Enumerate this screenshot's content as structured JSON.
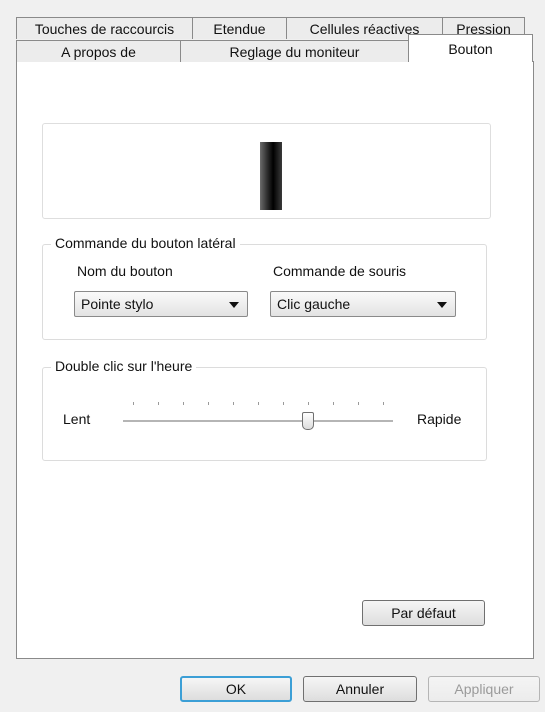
{
  "tabs": {
    "row1": [
      "Touches de raccourcis",
      "Etendue",
      "Cellules réactives",
      "Pression"
    ],
    "row2": [
      "A propos de",
      "Reglage du moniteur",
      "Bouton"
    ],
    "active": "Bouton"
  },
  "side_button_group": {
    "title": "Commande du bouton latéral",
    "button_name_label": "Nom du bouton",
    "button_name_value": "Pointe stylo",
    "mouse_command_label": "Commande de souris",
    "mouse_command_value": "Clic gauche"
  },
  "double_click_group": {
    "title": "Double clic sur l'heure",
    "slow_label": "Lent",
    "fast_label": "Rapide",
    "slider_value_fraction": 0.7
  },
  "buttons": {
    "default": "Par défaut",
    "ok": "OK",
    "cancel": "Annuler",
    "apply": "Appliquer"
  }
}
